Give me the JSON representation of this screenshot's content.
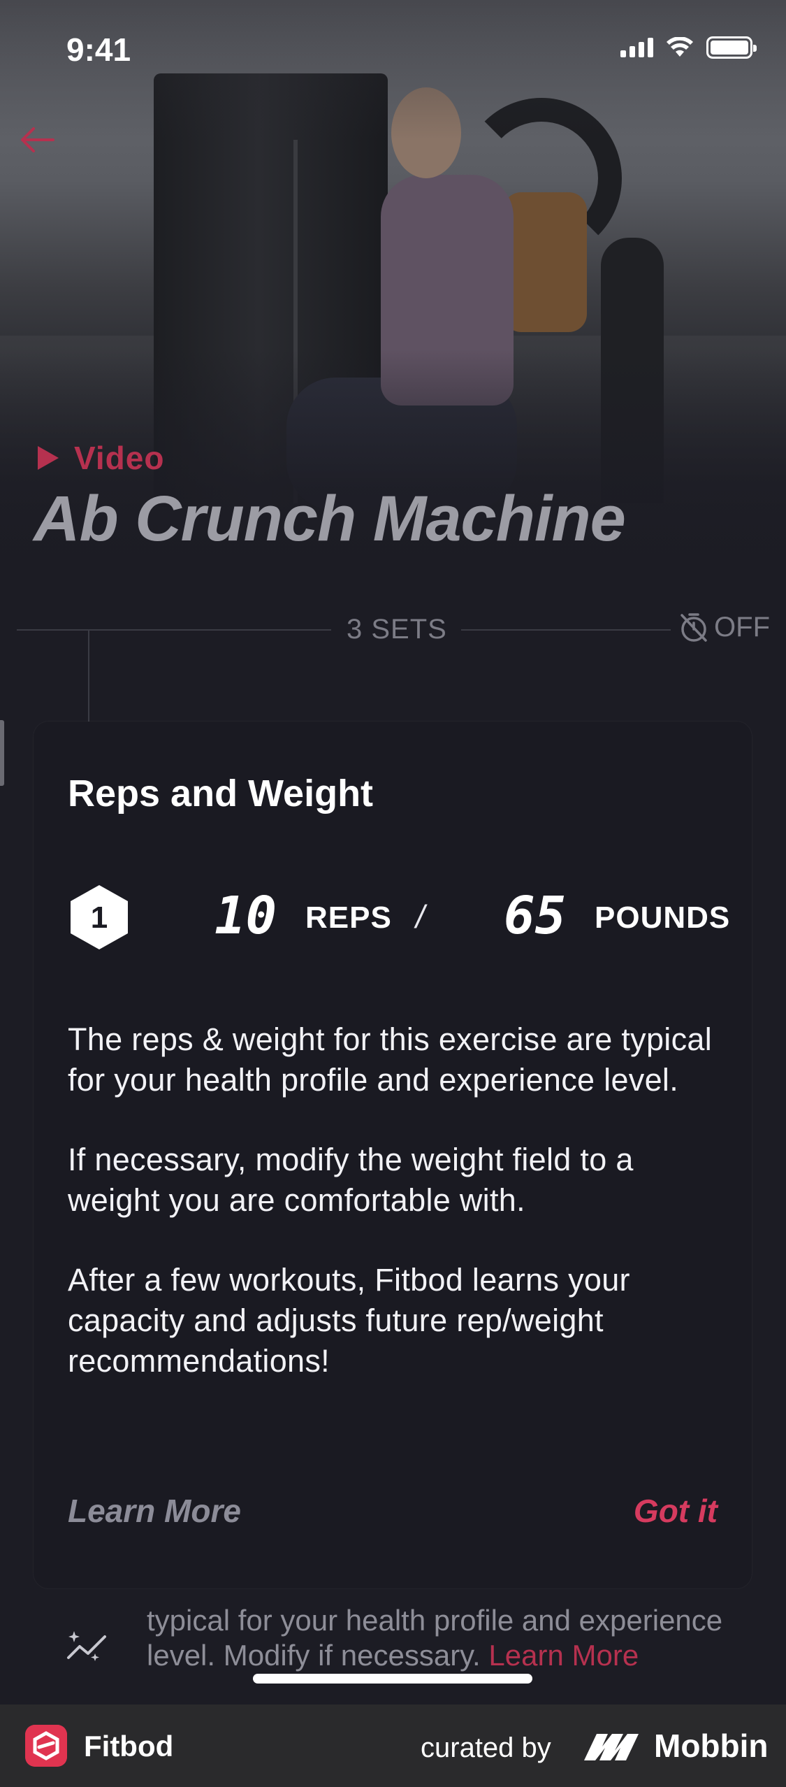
{
  "status_bar": {
    "time": "9:41"
  },
  "hero": {
    "video_label": "Video",
    "exercise_name": "Ab Crunch Machine"
  },
  "sets": {
    "label": "3 SETS",
    "timer_label": "OFF"
  },
  "modal": {
    "title": "Reps and Weight",
    "set_number": "1",
    "reps_value": "10",
    "reps_unit": "REPS",
    "separator": "/",
    "weight_value": "65",
    "weight_unit": "POUNDS",
    "paragraph_1": "The reps & weight for this exercise are typical for your health profile and experience level.",
    "paragraph_2": "If necessary, modify the weight field to a weight you are comfortable with.",
    "paragraph_3": "After a few workouts, Fitbod learns your capacity and adjusts future rep/weight recommendations!",
    "learn_more_label": "Learn More",
    "got_it_label": "Got it"
  },
  "tip": {
    "text": "typical for your health profile and experience level. Modify if necessary.",
    "link": "Learn More"
  },
  "footer": {
    "app_name": "Fitbod",
    "curated_label": "curated by",
    "brand_name": "Mobbin"
  },
  "colors": {
    "accent": "#d63b5f",
    "video_accent": "#b6314f",
    "card_bg": "#1a1a22",
    "page_bg": "#1c1c24"
  }
}
